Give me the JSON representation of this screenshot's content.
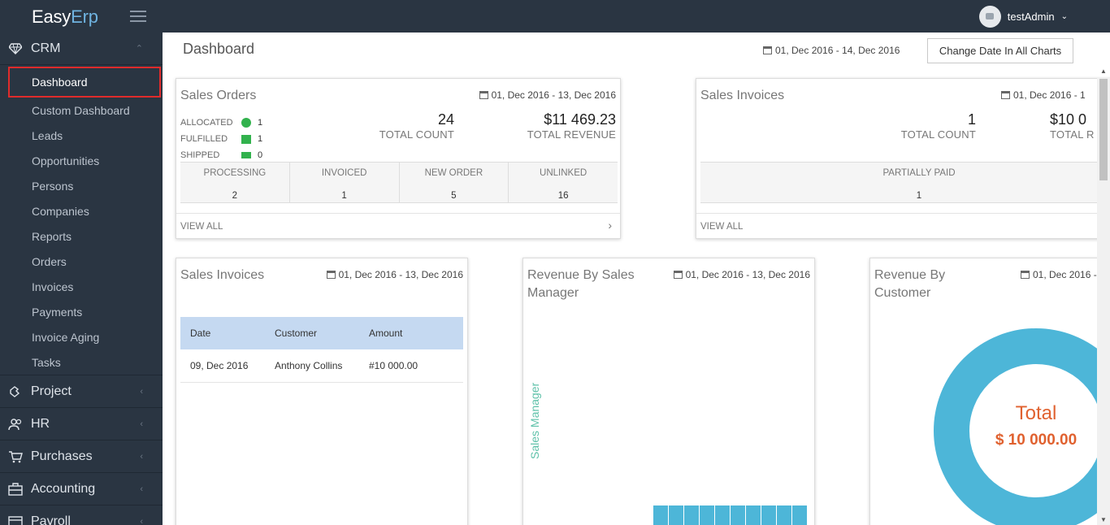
{
  "app": {
    "logo_part1": "Easy",
    "logo_part2": "Erp",
    "user": "testAdmin"
  },
  "colors": {
    "sidebar_bg": "#2a3542",
    "accent": "#4db6d8",
    "donut_text": "#e0612f",
    "active_outline": "#e02b2b",
    "table_head": "#c5d9f1"
  },
  "sidebar": {
    "crm": {
      "label": "CRM",
      "icon": "diamond-icon",
      "items": [
        "Dashboard",
        "Custom Dashboard",
        "Leads",
        "Opportunities",
        "Persons",
        "Companies",
        "Reports",
        "Orders",
        "Invoices",
        "Payments",
        "Invoice Aging",
        "Tasks"
      ],
      "active": "Dashboard"
    },
    "sections": [
      {
        "label": "Project",
        "icon": "puzzle-icon"
      },
      {
        "label": "HR",
        "icon": "users-icon"
      },
      {
        "label": "Purchases",
        "icon": "cart-icon"
      },
      {
        "label": "Accounting",
        "icon": "briefcase-icon"
      },
      {
        "label": "Payroll",
        "icon": "card-icon"
      }
    ]
  },
  "main": {
    "title": "Dashboard",
    "date_range": "01, Dec 2016 - 14, Dec 2016",
    "change_date_button": "Change Date In All Charts"
  },
  "sales_orders": {
    "title": "Sales Orders",
    "date": "01, Dec 2016 - 13, Dec 2016",
    "status": [
      {
        "label": "ALLOCATED",
        "value": "1"
      },
      {
        "label": "FULFILLED",
        "value": "1"
      },
      {
        "label": "SHIPPED",
        "value": "0"
      }
    ],
    "total_count": "24",
    "total_count_label": "TOTAL COUNT",
    "total_revenue": "$11 469.23",
    "total_revenue_label": "TOTAL REVENUE",
    "grid": [
      {
        "label": "PROCESSING",
        "value": "2"
      },
      {
        "label": "INVOICED",
        "value": "1"
      },
      {
        "label": "NEW ORDER",
        "value": "5"
      },
      {
        "label": "UNLINKED",
        "value": "16"
      }
    ],
    "view_all": "VIEW ALL"
  },
  "sales_invoices_summary": {
    "title": "Sales Invoices",
    "date": "01, Dec 2016 - 1",
    "total_count": "1",
    "total_count_label": "TOTAL COUNT",
    "total_revenue": "$10 0",
    "total_revenue_label": "TOTAL R",
    "grid": [
      {
        "label": "PARTIALLY PAID",
        "value": "1"
      }
    ],
    "view_all": "VIEW ALL"
  },
  "sales_invoices_table": {
    "title": "Sales Invoices",
    "date": "01, Dec 2016 - 13, Dec 2016",
    "columns": [
      "Date",
      "Customer",
      "Amount"
    ],
    "rows": [
      [
        "09, Dec 2016",
        "Anthony Collins",
        "#10 000.00"
      ]
    ]
  },
  "revenue_by_manager": {
    "title_line1": "Revenue By Sales",
    "title_line2": "Manager",
    "date": "01, Dec 2016 - 13, Dec 2016",
    "ylabel": "Sales Manager"
  },
  "revenue_by_customer": {
    "title_line1": "Revenue By",
    "title_line2": "Customer",
    "date": "01, Dec 2016 -",
    "center_label": "Total",
    "center_value": "$ 10 000.00"
  },
  "chart_data": [
    {
      "type": "bar",
      "title": "Revenue By Sales Manager",
      "ylabel": "Sales Manager",
      "categories": [],
      "values": []
    },
    {
      "type": "pie",
      "title": "Revenue By Customer",
      "labels": [
        "Anthony Collins"
      ],
      "values": [
        10000
      ]
    }
  ]
}
